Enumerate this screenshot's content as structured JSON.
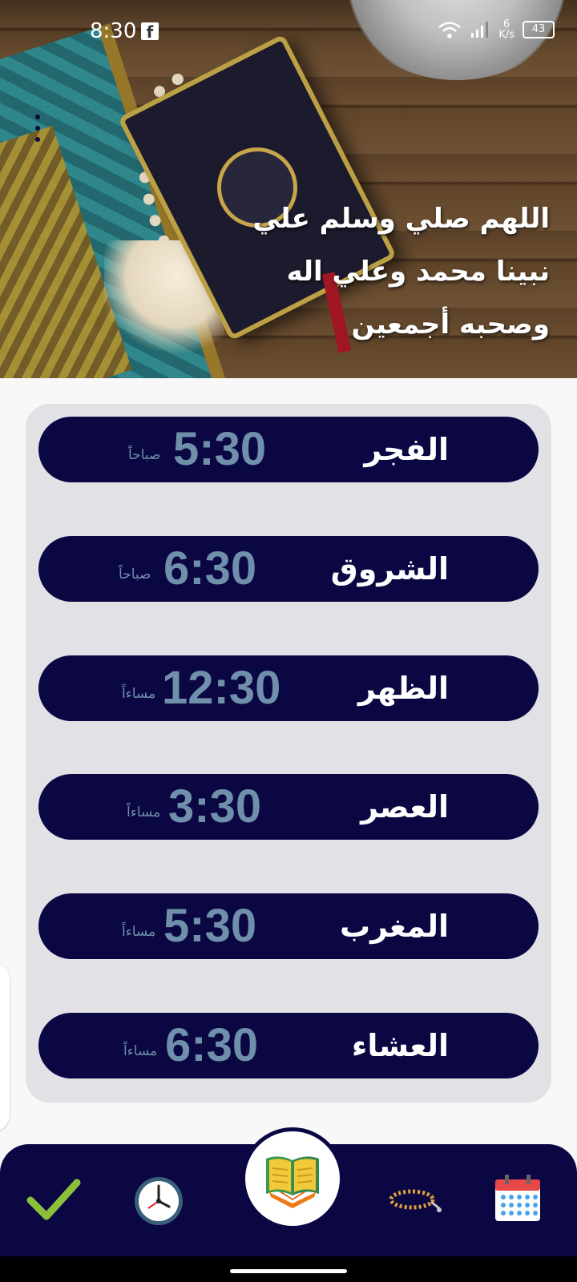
{
  "status_bar": {
    "time": "8:30",
    "fb_icon": "f",
    "speed_value": "6",
    "speed_unit": "K/s",
    "battery": "43"
  },
  "header": {
    "dua_lines": [
      "اللهم صلي وسلم علي",
      "نبينا محمد وعلي اله",
      "وصحبه أجمعين"
    ]
  },
  "prayers": [
    {
      "name": "الفجر",
      "time": "5:30",
      "period": "صباحاً"
    },
    {
      "name": "الشروق",
      "time": "6:30",
      "period": "صباحاً"
    },
    {
      "name": "الظهر",
      "time": "12:30",
      "period": "مساءاً"
    },
    {
      "name": "العصر",
      "time": "3:30",
      "period": "مساءاً"
    },
    {
      "name": "المغرب",
      "time": "5:30",
      "period": "مساءاً"
    },
    {
      "name": "العشاء",
      "time": "6:30",
      "period": "مساءاً"
    }
  ],
  "bottom_nav": {
    "items": [
      "checkmark-icon",
      "clock-icon",
      "quran-book-icon",
      "prayer-beads-icon",
      "calendar-icon"
    ]
  },
  "colors": {
    "pill_bg": "#0a0743",
    "time_text": "#6f8faa",
    "card_bg": "#e2e1e6"
  }
}
